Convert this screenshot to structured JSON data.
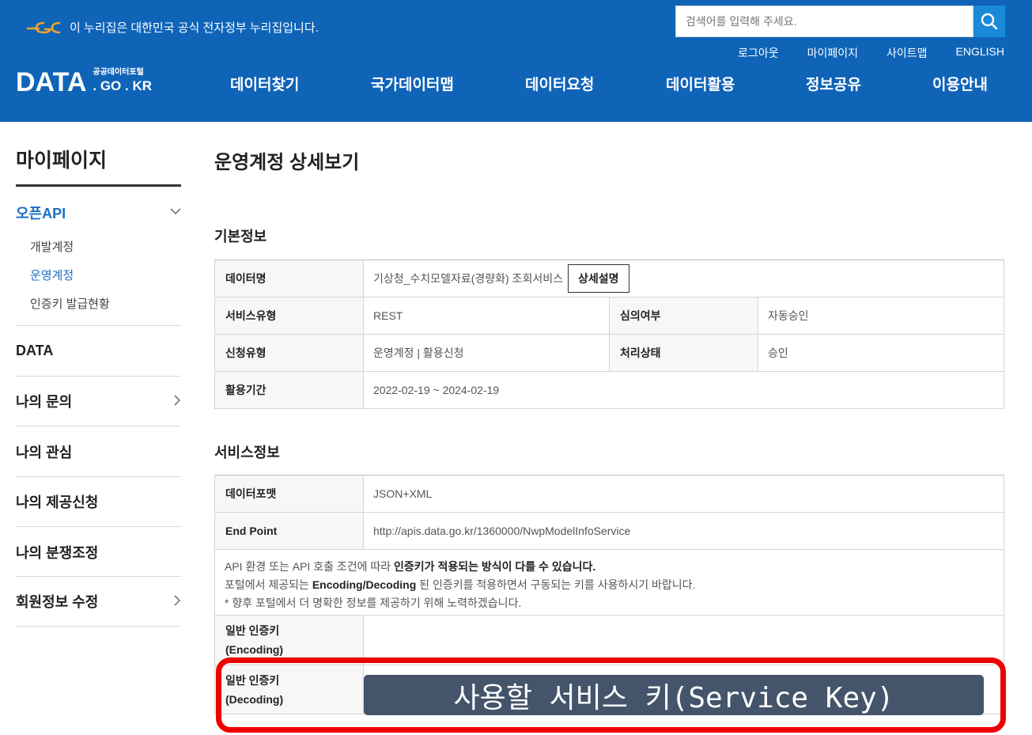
{
  "header": {
    "gov_notice": "이 누리집은 대한민국 공식 전자정부 누리집입니다.",
    "search_placeholder": "검색어를 입력해 주세요.",
    "util_nav": [
      "로그아웃",
      "마이페이지",
      "사이트맵",
      "ENGLISH"
    ],
    "brand_main": "DATA",
    "brand_sub_top": "공공데이터포털",
    "brand_sub_bottom": ". GO . KR",
    "main_nav": [
      "데이터찾기",
      "국가데이터맵",
      "데이터요청",
      "데이터활용",
      "정보공유",
      "이용안내"
    ],
    "colors": {
      "background": "#0f64b8",
      "search_button": "#1a8ad8"
    }
  },
  "sidebar": {
    "title": "마이페이지",
    "open_section": "오픈API",
    "sub_items": [
      "개발계정",
      "운영계정",
      "인증키 발급현황"
    ],
    "active_sub_item": "운영계정",
    "items": [
      "DATA",
      "나의 문의",
      "나의 관심",
      "나의 제공신청",
      "나의 분쟁조정",
      "회원정보 수정"
    ]
  },
  "main": {
    "page_title": "운영계정 상세보기",
    "basic_info": {
      "title": "기본정보",
      "data_name_label": "데이터명",
      "data_name_value": "기상청_수치모델자료(경량화) 조회서비스",
      "detail_button": "상세설명",
      "service_type_label": "서비스유형",
      "service_type_value": "REST",
      "review_label": "심의여부",
      "review_value": "자동승인",
      "request_type_label": "신청유형",
      "request_type_value": "운영계정 | 활용신청",
      "status_label": "처리상태",
      "status_value": "승인",
      "period_label": "활용기간",
      "period_value": "2022-02-19 ~ 2024-02-19"
    },
    "service_info": {
      "title": "서비스정보",
      "format_label": "데이터포맷",
      "format_value": "JSON+XML",
      "endpoint_label": "End Point",
      "endpoint_value": "http://apis.data.go.kr/1360000/NwpModelInfoService",
      "notice_line1_a": "API 환경 또는 API 호출 조건에 따라 ",
      "notice_line1_b": "인증키가 적용되는 방식이 다를 수 있습니다.",
      "notice_line2_a": "포털에서 제공되는 ",
      "notice_line2_b": "Encoding/Decoding",
      "notice_line2_c": " 된 인증키를 적용하면서 구동되는 키를 사용하시기 바랍니다.",
      "notice_line3": "* 향후 포털에서 더 명확한 정보를 제공하기 위해 노력하겠습니다.",
      "enc_key_label_1": "일반 인증키",
      "enc_key_label_2": "(Encoding)",
      "dec_key_label_1": "일반 인증키",
      "dec_key_label_2": "(Decoding)",
      "key_overlay_text": "사용할 서비스 키(Service Key)",
      "colors": {
        "key_overlay": "#44546a",
        "highlight_border": "#ee0000"
      }
    }
  }
}
